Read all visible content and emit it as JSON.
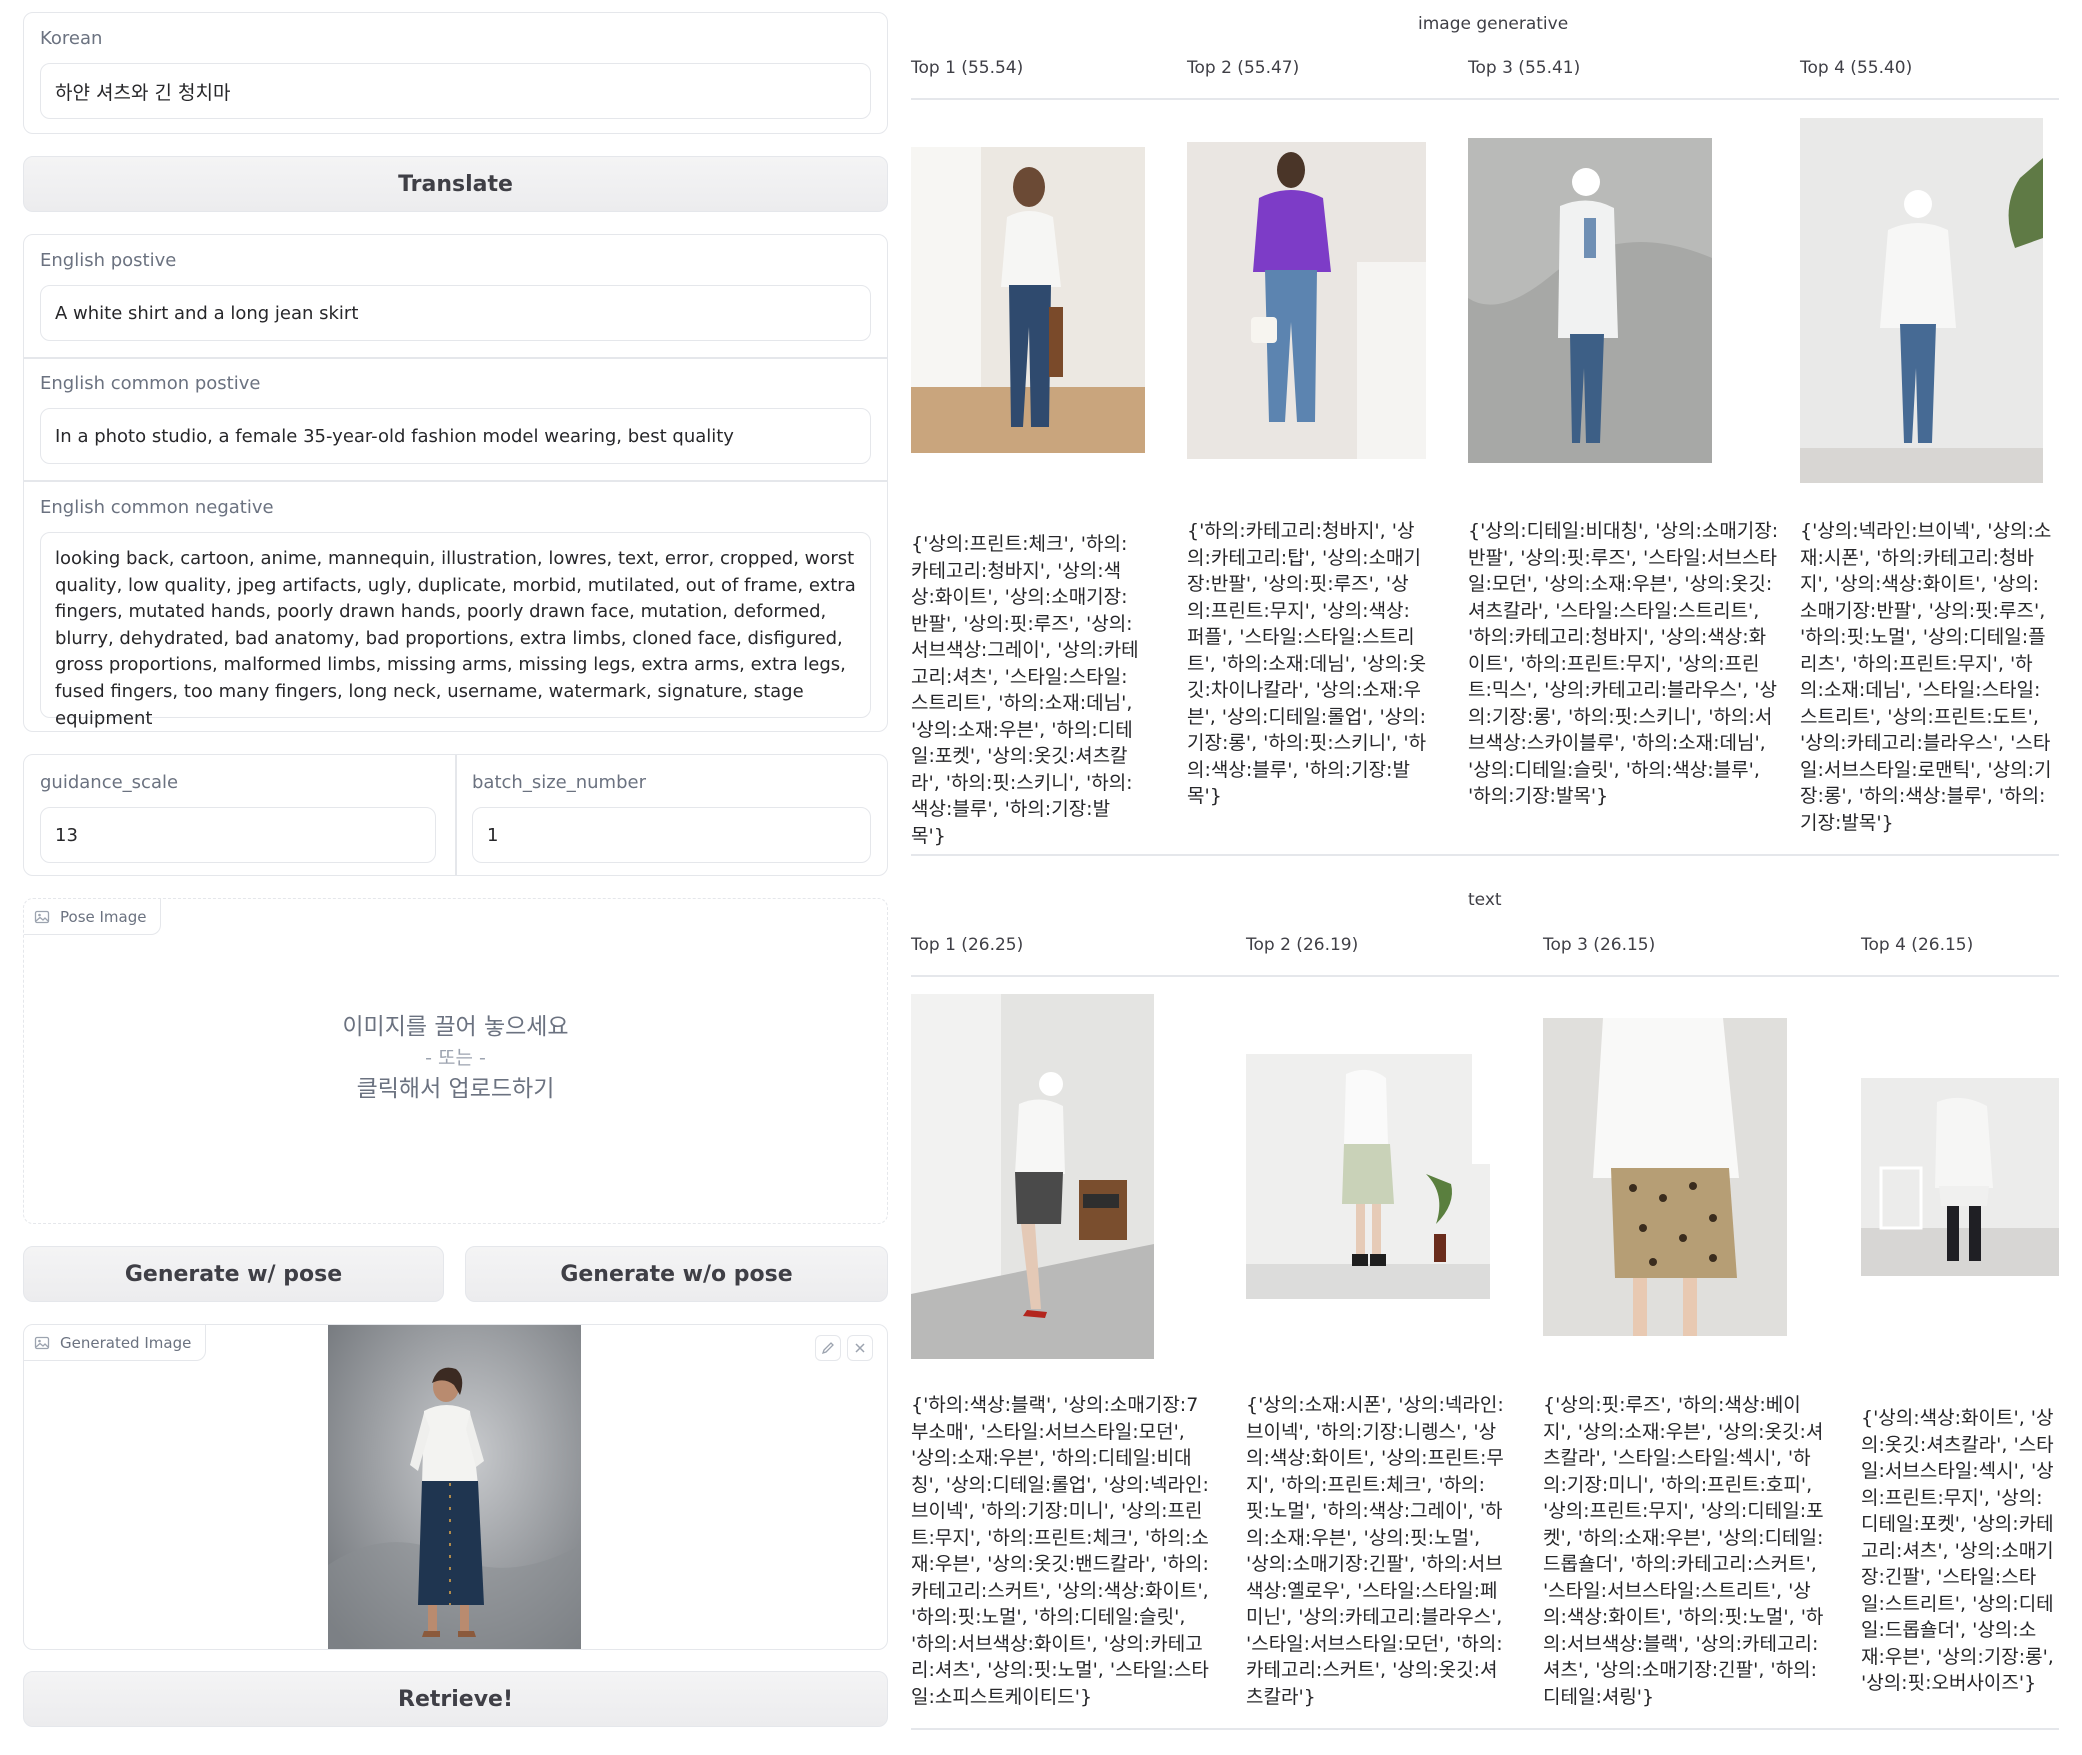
{
  "left": {
    "korean": {
      "label": "Korean",
      "value": "하얀 셔츠와 긴 청치마"
    },
    "translate_button": "Translate",
    "english_positive": {
      "label": "English postive",
      "value": "A white shirt and a long jean skirt"
    },
    "english_common_positive": {
      "label": "English common postive",
      "value": "In a photo studio, a female 35-year-old fashion model wearing, best quality"
    },
    "english_common_negative": {
      "label": "English common negative",
      "value": "looking back, cartoon, anime, mannequin, illustration, lowres, text, error, cropped, worst quality, low quality, jpeg artifacts, ugly, duplicate, morbid, mutilated, out of frame, extra fingers, mutated hands, poorly drawn hands, poorly drawn face, mutation, deformed, blurry, dehydrated, bad anatomy, bad proportions, extra limbs, cloned face, disfigured, gross proportions, malformed limbs, missing arms, missing legs, extra arms, extra legs, fused fingers, too many fingers, long neck, username, watermark, signature, stage equipment"
    },
    "guidance_scale": {
      "label": "guidance_scale",
      "value": "13"
    },
    "batch_size_number": {
      "label": "batch_size_number",
      "value": "1"
    },
    "pose_image": {
      "label": "Pose Image",
      "drop_line1": "이미지를 끌어 놓으세요",
      "drop_line2": "- 또는 -",
      "drop_line3": "클릭해서 업로드하기"
    },
    "generate_with_pose": "Generate w/ pose",
    "generate_without_pose": "Generate w/o pose",
    "generated_image": {
      "label": "Generated Image"
    },
    "retrieve_button": "Retrieve!"
  },
  "image_generative": {
    "title": "image generative",
    "results": [
      {
        "rank": "Top 1 (55.54)",
        "caption": "{'상의:프린트:체크', '하의:카테고리:청바지', '상의:색상:화이트', '상의:소매기장:반팔', '상의:핏:루즈', '상의:서브색상:그레이', '상의:카테고리:셔츠', '스타일:스타일:스트리트', '하의:소재:데님', '상의:소재:우븐', '하의:디테일:포켓', '상의:옷깃:셔츠칼라', '하의:핏:스키니', '하의:색상:블루', '하의:기장:발목'}"
      },
      {
        "rank": "Top 2 (55.47)",
        "caption": "{'하의:카테고리:청바지', '상의:카테고리:탑', '상의:소매기장:반팔', '상의:핏:루즈', '상의:프린트:무지', '상의:색상:퍼플', '스타일:스타일:스트리트', '하의:소재:데님', '상의:옷깃:차이나칼라', '상의:소재:우븐', '상의:디테일:롤업', '상의:기장:롱', '하의:핏:스키니', '하의:색상:블루', '하의:기장:발목'}"
      },
      {
        "rank": "Top 3 (55.41)",
        "caption": "{'상의:디테일:비대칭', '상의:소매기장:반팔', '상의:핏:루즈', '스타일:서브스타일:모던', '상의:소재:우븐', '상의:옷깃:셔츠칼라', '스타일:스타일:스트리트', '하의:카테고리:청바지', '상의:색상:화이트', '하의:프린트:무지', '상의:프린트:믹스', '상의:카테고리:블라우스', '상의:기장:롱', '하의:핏:스키니', '하의:서브색상:스카이블루', '하의:소재:데님', '상의:디테일:슬릿', '하의:색상:블루', '하의:기장:발목'}"
      },
      {
        "rank": "Top 4 (55.40)",
        "caption": "{'상의:넥라인:브이넥', '상의:소재:시폰', '하의:카테고리:청바지', '상의:색상:화이트', '상의:소매기장:반팔', '상의:핏:루즈', '하의:핏:노멀', '상의:디테일:플리츠', '하의:프린트:무지', '하의:소재:데님', '스타일:스타일:스트리트', '상의:프린트:도트', '상의:카테고리:블라우스', '스타일:서브스타일:로맨틱', '상의:기장:롱', '하의:색상:블루', '하의:기장:발목'}"
      }
    ]
  },
  "text": {
    "title": "text",
    "results": [
      {
        "rank": "Top 1 (26.25)",
        "caption": "{'하의:색상:블랙', '상의:소매기장:7부소매', '스타일:서브스타일:모던', '상의:소재:우븐', '하의:디테일:비대칭', '상의:디테일:롤업', '상의:넥라인:브이넥', '하의:기장:미니', '상의:프린트:무지', '하의:프린트:체크', '하의:소재:우븐', '상의:옷깃:밴드칼라', '하의:카테고리:스커트', '상의:색상:화이트', '하의:핏:노멀', '하의:디테일:슬릿', '하의:서브색상:화이트', '상의:카테고리:셔츠', '상의:핏:노멀', '스타일:스타일:소피스트케이티드'}"
      },
      {
        "rank": "Top 2 (26.19)",
        "caption": "{'상의:소재:시폰', '상의:넥라인:브이넥', '하의:기장:니렝스', '상의:색상:화이트', '상의:프린트:무지', '하의:프린트:체크', '하의:핏:노멀', '하의:색상:그레이', '하의:소재:우븐', '상의:핏:노멀', '상의:소매기장:긴팔', '하의:서브색상:옐로우', '스타일:스타일:페미닌', '상의:카테고리:블라우스', '스타일:서브스타일:모던', '하의:카테고리:스커트', '상의:옷깃:셔츠칼라'}"
      },
      {
        "rank": "Top 3 (26.15)",
        "caption": "{'상의:핏:루즈', '하의:색상:베이지', '상의:소재:우븐', '상의:옷깃:셔츠칼라', '스타일:스타일:섹시', '하의:기장:미니', '하의:프린트:호피', '상의:프린트:무지', '상의:디테일:포켓', '하의:소재:우븐', '상의:디테일:드롭숄더', '하의:카테고리:스커트', '스타일:서브스타일:스트리트', '상의:색상:화이트', '하의:핏:노멀', '하의:서브색상:블랙', '상의:카테고리:셔츠', '상의:소매기장:긴팔', '하의:디테일:셔링'}"
      },
      {
        "rank": "Top 4 (26.15)",
        "caption": "{'상의:색상:화이트', '상의:옷깃:셔츠칼라', '스타일:서브스타일:섹시', '상의:프린트:무지', '상의:디테일:포켓', '상의:카테고리:셔츠', '상의:소매기장:긴팔', '스타일:스타일:스트리트', '상의:디테일:드롭숄더', '상의:소재:우븐', '상의:기장:롱', '상의:핏:오버사이즈'}"
      }
    ]
  }
}
